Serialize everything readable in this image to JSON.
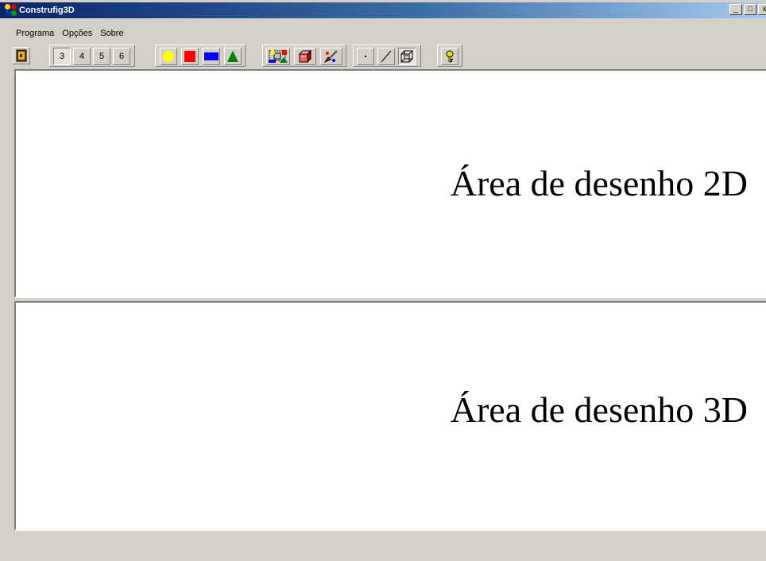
{
  "window": {
    "title": "Construfig3D",
    "caption_buttons": {
      "minimize": "_",
      "maximize": "□",
      "close": "x"
    }
  },
  "menubar": {
    "items": [
      {
        "label": "Programa"
      },
      {
        "label": "Opções"
      },
      {
        "label": "Sobre"
      }
    ]
  },
  "toolbar": {
    "sides": [
      "3",
      "4",
      "5",
      "6"
    ],
    "selected_side": "3",
    "shape_colors": [
      {
        "icon": "yellow-circle-icon",
        "color": "#ffff00"
      },
      {
        "icon": "red-square-icon",
        "color": "#ff0000"
      },
      {
        "icon": "blue-rectangle-icon",
        "color": "#0000ff"
      },
      {
        "icon": "green-triangle-icon",
        "color": "#008000"
      }
    ],
    "tools": [
      "shape-palette-icon",
      "3d-box-icon",
      "paint-brush-icon"
    ],
    "draw_modes": [
      "point-icon",
      "line-icon",
      "wireframe-cube-icon"
    ],
    "help": "help-key-icon"
  },
  "panels": {
    "area_2d_label": "Área de desenho 2D",
    "area_3d_label": "Área de desenho 3D"
  },
  "colors": {
    "titlebar_start": "#0a246a",
    "titlebar_end": "#a6caf0",
    "face": "#d4d0c8",
    "canvas": "#ffffff"
  }
}
